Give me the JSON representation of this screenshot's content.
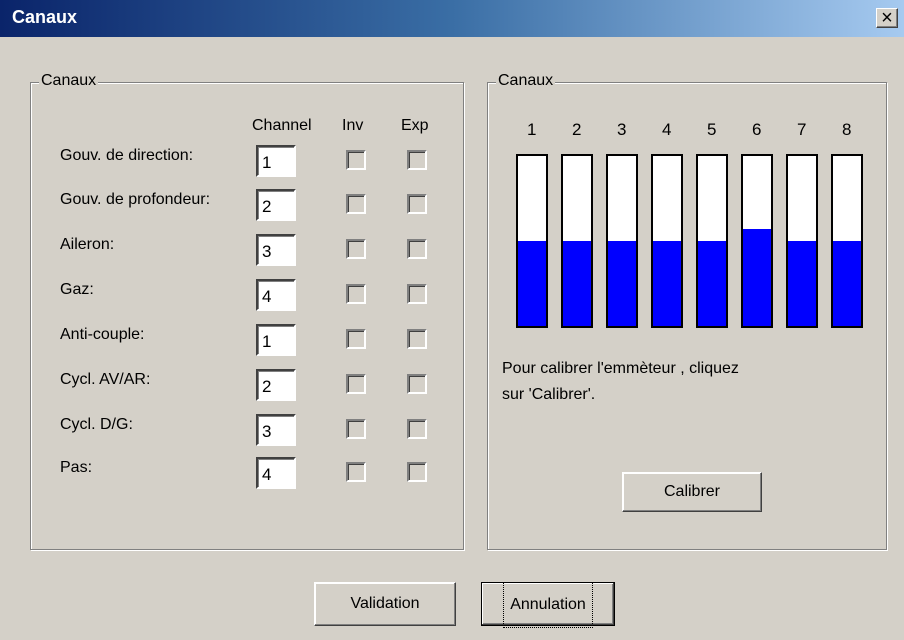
{
  "window": {
    "title": "Canaux",
    "close_label": "×"
  },
  "left_group": {
    "title": "Canaux",
    "headers": {
      "channel": "Channel",
      "inv": "Inv",
      "exp": "Exp"
    },
    "rows": [
      {
        "label": "Gouv. de direction:",
        "channel": "1",
        "inv": false,
        "exp": false
      },
      {
        "label": "Gouv. de profondeur:",
        "channel": "2",
        "inv": false,
        "exp": false
      },
      {
        "label": "Aileron:",
        "channel": "3",
        "inv": false,
        "exp": false
      },
      {
        "label": "Gaz:",
        "channel": "4",
        "inv": false,
        "exp": false
      },
      {
        "label": "Anti-couple:",
        "channel": "1",
        "inv": false,
        "exp": false
      },
      {
        "label": "Cycl. AV/AR:",
        "channel": "2",
        "inv": false,
        "exp": false
      },
      {
        "label": "Cycl. D/G:",
        "channel": "3",
        "inv": false,
        "exp": false
      },
      {
        "label": "Pas:",
        "channel": "4",
        "inv": false,
        "exp": false
      }
    ]
  },
  "right_group": {
    "title": "Canaux",
    "channels": [
      {
        "label": "1",
        "level": 0.5
      },
      {
        "label": "2",
        "level": 0.5
      },
      {
        "label": "3",
        "level": 0.5
      },
      {
        "label": "4",
        "level": 0.5
      },
      {
        "label": "5",
        "level": 0.5
      },
      {
        "label": "6",
        "level": 0.57
      },
      {
        "label": "7",
        "level": 0.5
      },
      {
        "label": "8",
        "level": 0.5
      }
    ],
    "bar_color": "#0000ff",
    "instruction_line1": "Pour calibrer l'emmèteur , cliquez",
    "instruction_line2": "sur 'Calibrer'.",
    "calibrate_label": "Calibrer"
  },
  "footer": {
    "validation_label": "Validation",
    "cancel_label": "Annulation"
  }
}
